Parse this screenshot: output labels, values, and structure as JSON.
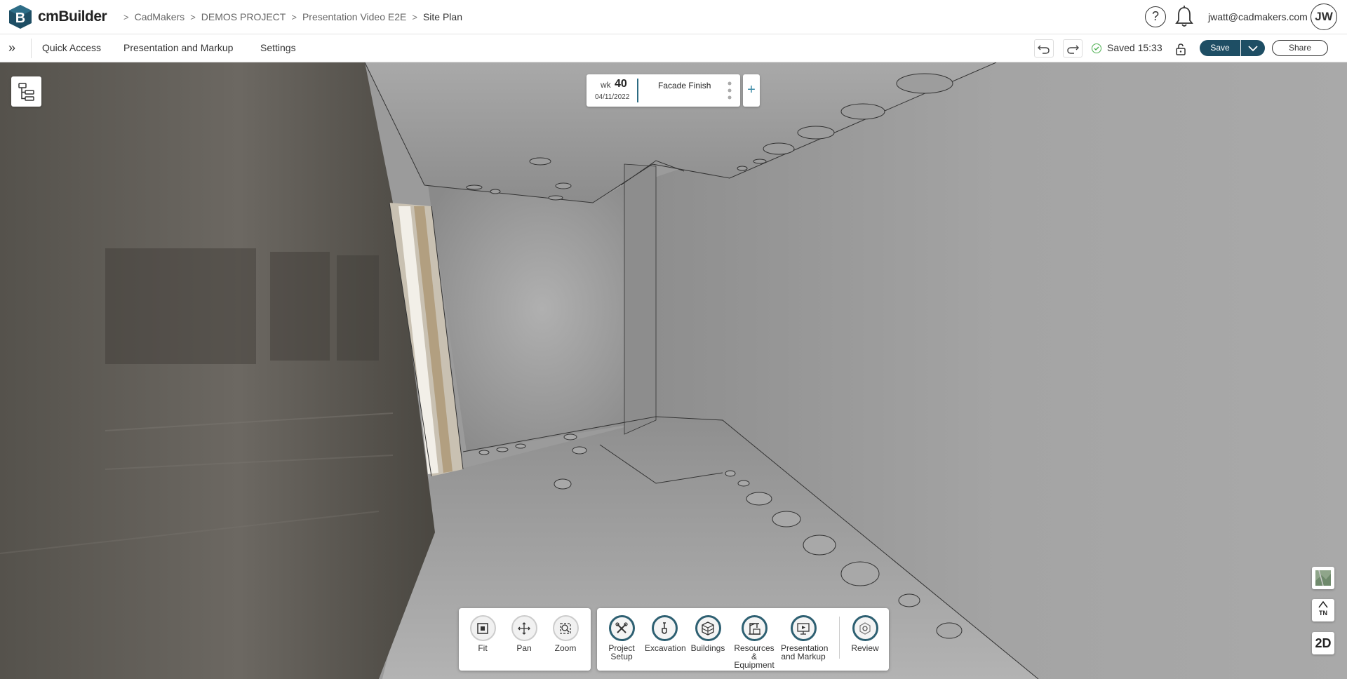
{
  "app": {
    "brand": "cmBuilder"
  },
  "breadcrumb": [
    "CadMakers",
    "DEMOS PROJECT",
    "Presentation Video E2E",
    "Site Plan"
  ],
  "header": {
    "help_label": "?",
    "user_email": "jwatt@cadmakers.com",
    "avatar_initials": "JW"
  },
  "menu": {
    "items": [
      "Quick Access",
      "Presentation and Markup",
      "Settings"
    ]
  },
  "status": {
    "saved_text": "Saved 15:33"
  },
  "actions": {
    "save_label": "Save",
    "share_label": "Share"
  },
  "timeline": {
    "wk_label": "wk",
    "week": "40",
    "date": "04/11/2022",
    "phase": "Facade Finish",
    "add_label": "+"
  },
  "right_tools": {
    "tn_label": "TN",
    "twod_label": "2D"
  },
  "view_tools": [
    {
      "label": "Fit",
      "icon": "fit-icon"
    },
    {
      "label": "Pan",
      "icon": "pan-icon"
    },
    {
      "label": "Zoom",
      "icon": "zoom-icon"
    }
  ],
  "workflow_tools": [
    {
      "label": "Project Setup",
      "icon": "tools-icon"
    },
    {
      "label": "Excavation",
      "icon": "shovel-icon"
    },
    {
      "label": "Buildings",
      "icon": "buildings-icon"
    },
    {
      "label": "Resources & Equipment",
      "icon": "crane-icon"
    },
    {
      "label": "Presentation and Markup",
      "icon": "presentation-icon"
    },
    {
      "label": "Review",
      "icon": "review-icon"
    }
  ],
  "colors": {
    "accent": "#1e4e64",
    "saved_ok": "#4caf50"
  }
}
